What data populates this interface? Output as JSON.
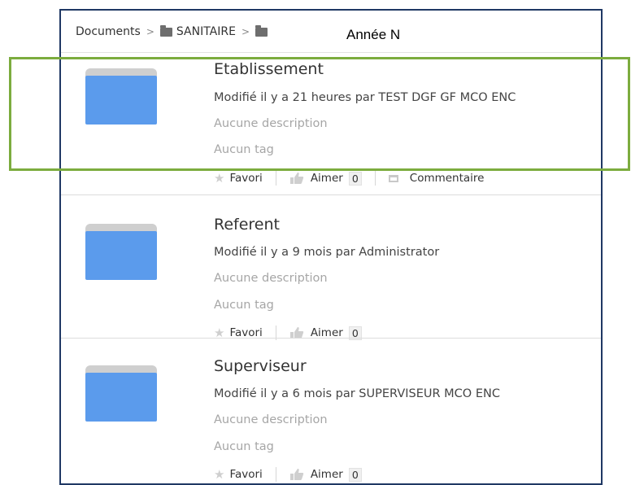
{
  "breadcrumb": {
    "root": "Documents",
    "separator": ">",
    "folder1": "SANITAIRE",
    "current": "Année N"
  },
  "items": [
    {
      "title": "Etablissement",
      "modified": "Modifié il y a 21 heures par TEST DGF GF MCO ENC",
      "description": "Aucune description",
      "tags": "Aucun tag",
      "favorite_label": "Favori",
      "like_label": "Aimer",
      "like_count": "0",
      "comment_label": "Commentaire"
    },
    {
      "title": "Referent",
      "modified": "Modifié il y a 9 mois par Administrator",
      "description": "Aucune description",
      "tags": "Aucun tag",
      "favorite_label": "Favori",
      "like_label": "Aimer",
      "like_count": "0"
    },
    {
      "title": "Superviseur",
      "modified": "Modifié il y a 6 mois par SUPERVISEUR MCO ENC",
      "description": "Aucune description",
      "tags": "Aucun tag",
      "favorite_label": "Favori",
      "like_label": "Aimer",
      "like_count": "0"
    }
  ],
  "colors": {
    "folder_blue": "#5b9bec",
    "highlight_green": "#7cac3e",
    "frame_border": "#1f3864"
  }
}
